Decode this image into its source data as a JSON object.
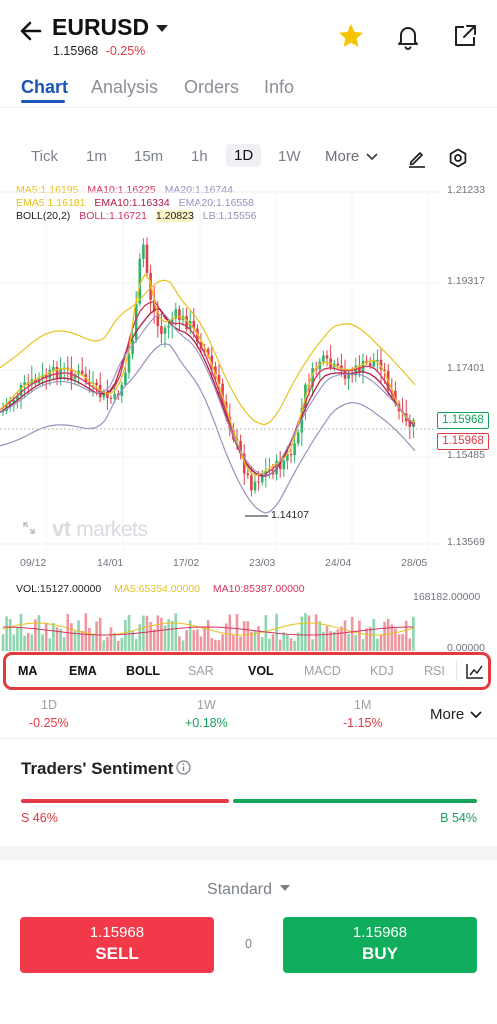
{
  "header": {
    "symbol": "EURUSD",
    "price": "1.15968",
    "change": "-0.25%"
  },
  "tabs": [
    "Chart",
    "Analysis",
    "Orders",
    "Info"
  ],
  "timeframes": {
    "items": [
      "Tick",
      "1m",
      "15m",
      "1h",
      "1D",
      "1W"
    ],
    "active": "1D",
    "more": "More"
  },
  "legend": {
    "ma5": "MA5:1.16195",
    "ma10": "MA10:1.16225",
    "ma20": "MA20:1.16744",
    "ema5": "EMA5:1.16181",
    "ema10": "EMA10:1.16334",
    "ema20": "EMA20:1.16558",
    "boll": "BOLL(20,2)",
    "boll_mid": "BOLL:1.16721",
    "ub": "1.20823",
    "lb": "LB:1.15556"
  },
  "chart_data": {
    "type": "candlestick",
    "symbol": "EURUSD",
    "y_ticks": [
      "1.21233",
      "1.19317",
      "1.17401",
      "1.15485",
      "1.13569"
    ],
    "x_ticks": [
      "09/12",
      "14/01",
      "17/02",
      "23/03",
      "24/04",
      "28/05"
    ],
    "ylim": [
      1.13569,
      1.21233
    ],
    "current_price": "1.15968",
    "ask_tag": "1.15968",
    "bid_tag": "1.15968",
    "low_annotation": "1.14107",
    "volume": {
      "legend_vol": "VOL:15127.00000",
      "legend_ma5": "MA5:65354.00000",
      "legend_ma10": "MA10:85387.00000",
      "y_ticks": [
        "168182.00000",
        "0.00000"
      ]
    }
  },
  "watermark": {
    "a": "vt",
    "b": "markets"
  },
  "indicators": {
    "items": [
      "MA",
      "EMA",
      "BOLL",
      "SAR",
      "VOL",
      "MACD",
      "KDJ",
      "RSI"
    ],
    "active": [
      "MA",
      "EMA",
      "BOLL",
      "VOL"
    ]
  },
  "performance": [
    {
      "label": "1D",
      "value": "-0.25%",
      "dir": "down"
    },
    {
      "label": "1W",
      "value": "+0.18%",
      "dir": "up"
    },
    {
      "label": "1M",
      "value": "-1.15%",
      "dir": "down"
    }
  ],
  "performance_more": "More",
  "sentiment": {
    "title": "Traders' Sentiment",
    "sell_label": "S 46%",
    "buy_label": "B 54%",
    "sell_pct": 46,
    "buy_pct": 54
  },
  "account_type": "Standard",
  "trade": {
    "sell_price": "1.15968",
    "sell_label": "SELL",
    "buy_price": "1.15968",
    "buy_label": "BUY",
    "spread": "0"
  },
  "colors": {
    "up": "#13a45a",
    "down": "#e03a44",
    "accent": "#1b54b8",
    "ma5": "#e8c21b",
    "ma10": "#d8325c",
    "ma20": "#9a8fbe"
  }
}
